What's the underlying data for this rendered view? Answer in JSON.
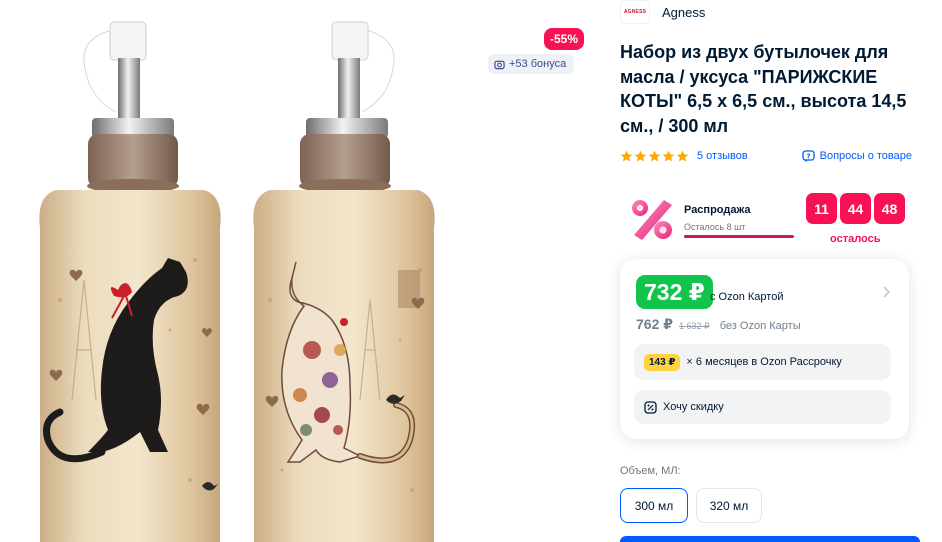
{
  "gallery": {
    "discount_badge": "-55%",
    "bonus_badge": "+53 бонуса",
    "bonus_icon": "camera-icon"
  },
  "brand": {
    "logo_text": "AGNESS",
    "name": "Agness"
  },
  "product": {
    "title": "Набор из двух бутылочек для масла / уксуса \"ПАРИЖСКИЕ КОТЫ\" 6,5 х 6,5 см., высота 14,5 см., / 300 мл"
  },
  "rating": {
    "stars": 5,
    "star_color": "#ffa800",
    "reviews_label": "5 отзывов",
    "questions_label": "Вопросы о товаре"
  },
  "sale": {
    "title": "Распродажа",
    "remaining_label": "Осталось 8 шт",
    "progress": 1.0,
    "timer": [
      "11",
      "44",
      "48"
    ],
    "timer_label": "осталось"
  },
  "price": {
    "card_price": "732 ₽",
    "card_price_label": "с Ozon Картой",
    "regular_price": "762 ₽",
    "old_price": "1 632 ₽",
    "regular_price_label": "без Ozon Карты",
    "installment_amount": "143 ₽",
    "installment_text": "× 6 месяцев в Ozon Рассрочку",
    "want_discount_label": "Хочу скидку"
  },
  "volume": {
    "label": "Объем, МЛ:",
    "options": [
      "300 мл",
      "320 мл"
    ],
    "selected": "300 мл"
  },
  "colors": {
    "accent": "#005bff",
    "sale_red": "#f91155",
    "price_green": "#10c44c"
  }
}
